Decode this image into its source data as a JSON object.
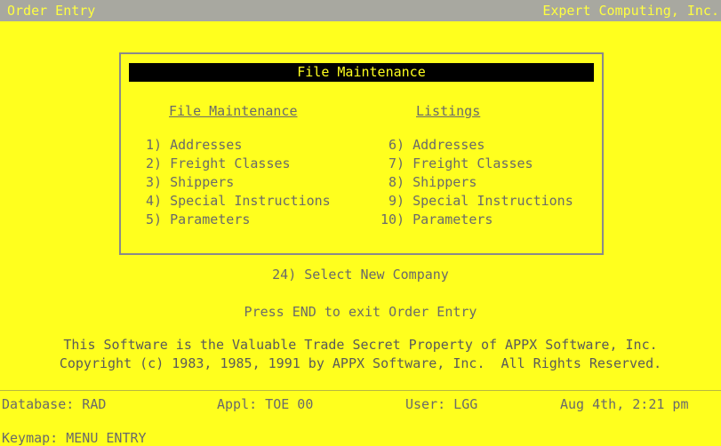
{
  "header": {
    "app_title": "Order Entry",
    "company": "Expert Computing, Inc."
  },
  "menu": {
    "title": "File Maintenance",
    "left_heading": "File Maintenance",
    "right_heading": "Listings",
    "left_items": [
      "1) Addresses",
      "2) Freight Classes",
      "3) Shippers",
      "4) Special Instructions",
      "5) Parameters"
    ],
    "right_items": [
      " 6) Addresses",
      " 7) Freight Classes",
      " 8) Shippers",
      " 9) Special Instructions",
      "10) Parameters"
    ]
  },
  "options": {
    "select_company": "24) Select New Company",
    "exit_hint": "Press END to exit Order Entry"
  },
  "legal": {
    "line1": "This Software is the Valuable Trade Secret Property of APPX Software, Inc.",
    "line2": "Copyright (c) 1983, 1985, 1991 by APPX Software, Inc.  All Rights Reserved."
  },
  "status": {
    "database": "Database: RAD",
    "appl": "Appl: TOE 00",
    "user": "User: LGG",
    "datetime": "Aug 4th, 2:21 pm"
  },
  "keymap": "Keymap: MENU ENTRY"
}
